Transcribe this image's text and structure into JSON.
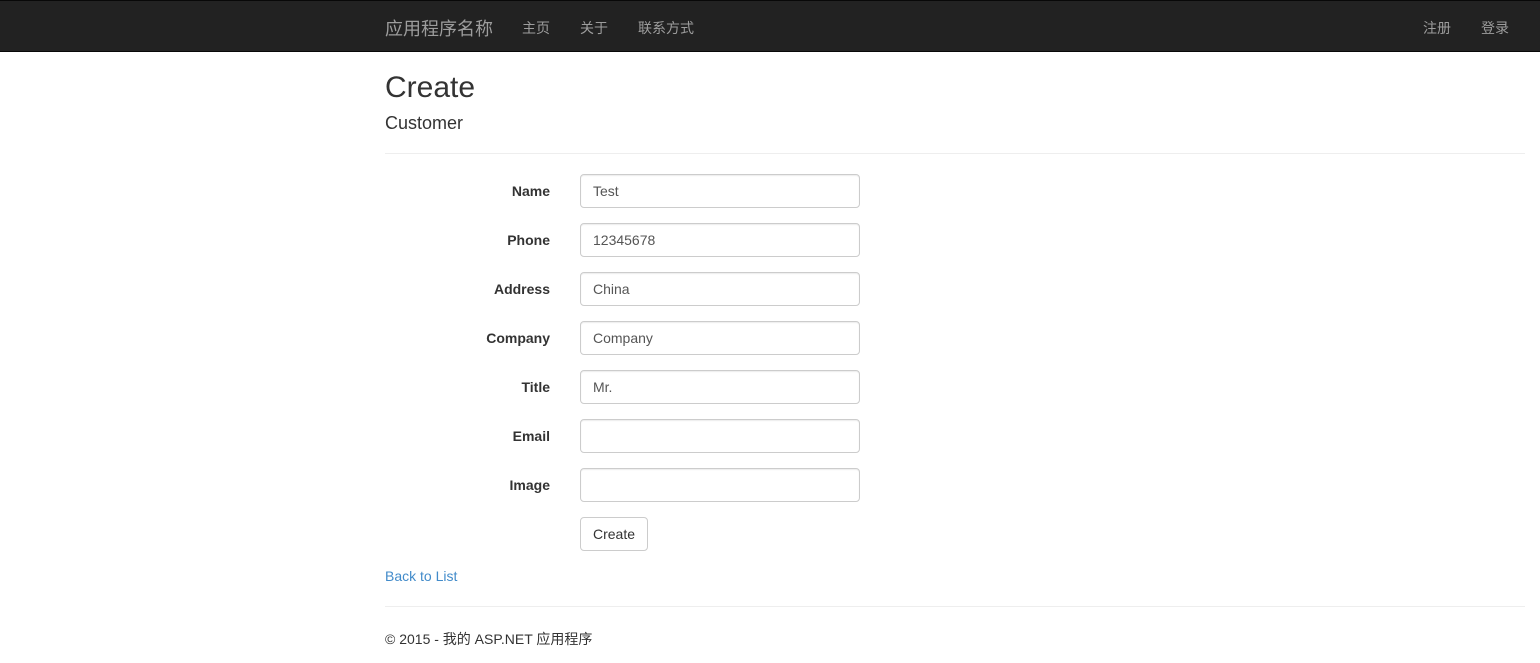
{
  "navbar": {
    "brand": "应用程序名称",
    "links": [
      "主页",
      "关于",
      "联系方式"
    ],
    "right_links": [
      "注册",
      "登录"
    ]
  },
  "page": {
    "title": "Create",
    "subtitle": "Customer"
  },
  "form": {
    "fields": [
      {
        "label": "Name",
        "value": "Test"
      },
      {
        "label": "Phone",
        "value": "12345678"
      },
      {
        "label": "Address",
        "value": "China"
      },
      {
        "label": "Company",
        "value": "Company"
      },
      {
        "label": "Title",
        "value": "Mr."
      },
      {
        "label": "Email",
        "value": ""
      },
      {
        "label": "Image",
        "value": ""
      }
    ],
    "submit_label": "Create"
  },
  "back_link": "Back to List",
  "footer": "© 2015 - 我的 ASP.NET 应用程序",
  "colors": {
    "navbar_bg": "#222222",
    "nav_text": "#9d9d9d",
    "link": "#428bca"
  }
}
